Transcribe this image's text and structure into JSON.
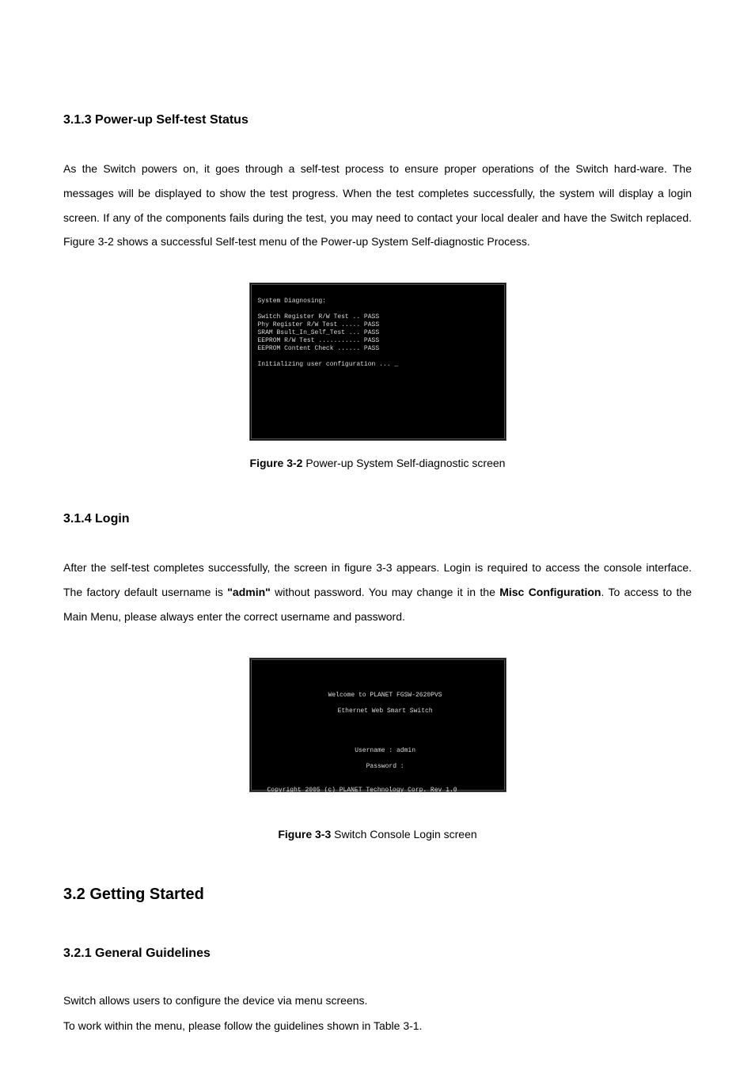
{
  "sec313": {
    "heading": "3.1.3 Power-up Self-test Status",
    "para": "As the Switch powers on, it goes through a self-test process to ensure proper operations of the Switch hard-ware. The messages will be displayed to show the test progress. When the test completes successfully, the system will display a login screen. If any of the components fails during the test, you may need to contact your local dealer and have the Switch replaced. Figure 3-2 shows a successful Self-test menu of the Power-up System Self-diagnostic Process.",
    "terminal": "System Diagnosing:\n\nSwitch Register R/W Test .. PASS\nPhy Register R/W Test ..... PASS\nSRAM Bsult_In_Self_Test ... PASS\nEEPROM R/W Test ........... PASS\nEEPROM Content Check ...... PASS\n\nInitializing user configuration ... _",
    "caption_b": "Figure 3-2",
    "caption_r": " Power-up System Self-diagnostic screen"
  },
  "sec314": {
    "heading": "3.1.4 Login",
    "para_pre": "After the self-test completes successfully, the screen in figure 3-3 appears. Login is required to access the console interface. The factory default username is ",
    "para_bold1": "\"admin\"",
    "para_mid": " without password. You may change it in the ",
    "para_bold2": "Misc Configuration",
    "para_post": ". To access to the Main Menu, please always enter the correct username and password.",
    "term_line1": "Welcome to PLANET FGSW-2620PVS",
    "term_line2": "Ethernet Web Smart Switch",
    "term_user": "Username : admin",
    "term_pass": "Password :",
    "term_copy": "Copyright 2005 (c) PLANET Technology Corp. Rev 1.0",
    "caption_b": "Figure 3-3",
    "caption_r": " Switch Console Login screen"
  },
  "sec32": {
    "heading": "3.2 Getting Started"
  },
  "sec321": {
    "heading": "3.2.1 General Guidelines",
    "p1": "Switch allows users to configure the device via menu screens.",
    "p2": "To work within the menu, please follow the guidelines shown in Table 3-1."
  }
}
